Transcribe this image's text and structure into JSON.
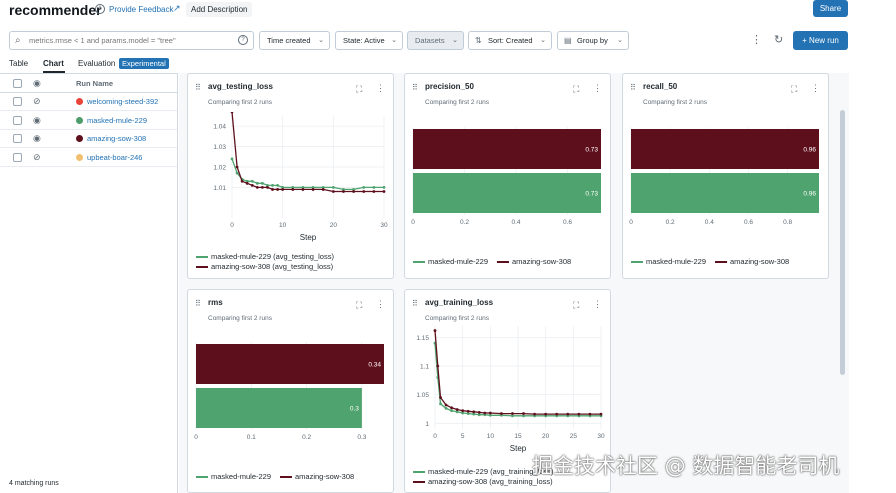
{
  "header": {
    "title": "recommender",
    "feedback": "Provide Feedback",
    "add_description": "Add Description",
    "share": "Share"
  },
  "toolbar": {
    "search_placeholder": "metrics.rmse < 1 and params.model = \"tree\"",
    "time_created": "Time created",
    "state": "State: Active",
    "datasets": "Datasets",
    "sort": "Sort: Created",
    "group_by": "Group by",
    "new_run": "New run"
  },
  "tabs": {
    "table": "Table",
    "chart": "Chart",
    "evaluation": "Evaluation",
    "experimental": "Experimental"
  },
  "runs": {
    "column_header": "Run Name",
    "items": [
      {
        "name": "welcoming-steed-392",
        "color": "#e8443a",
        "visible": false
      },
      {
        "name": "masked-mule-229",
        "color": "#4c9e6a",
        "visible": true
      },
      {
        "name": "amazing-sow-308",
        "color": "#5e0f1c",
        "visible": true
      },
      {
        "name": "upbeat-boar-246",
        "color": "#f0c070",
        "visible": false
      }
    ],
    "matching": "4 matching runs"
  },
  "colors": {
    "masked": "#4fa36e",
    "amazing": "#5e0f1c",
    "accent": "#2272b4"
  },
  "charts": {
    "subtitle": "Comparing first 2 runs",
    "avg_testing_loss": {
      "title": "avg_testing_loss",
      "xlabel": "Step",
      "legend": [
        "masked-mule-229 (avg_testing_loss)",
        "amazing-sow-308 (avg_testing_loss)"
      ]
    },
    "precision_50": {
      "title": "precision_50",
      "legend": [
        "masked-mule-229",
        "amazing-sow-308"
      ]
    },
    "recall_50": {
      "title": "recall_50",
      "legend": [
        "masked-mule-229",
        "amazing-sow-308"
      ]
    },
    "rms": {
      "title": "rms",
      "legend": [
        "masked-mule-229",
        "amazing-sow-308"
      ]
    },
    "avg_training_loss": {
      "title": "avg_training_loss",
      "xlabel": "Step",
      "legend": [
        "masked-mule-229 (avg_training_loss)",
        "amazing-sow-308 (avg_training_loss)"
      ]
    }
  },
  "chart_data": [
    {
      "type": "line",
      "title": "avg_testing_loss",
      "xlabel": "Step",
      "xlim": [
        0,
        30
      ],
      "ylim": [
        0.995,
        1.045
      ],
      "yticks": [
        1.01,
        1.02,
        1.03,
        1.04
      ],
      "xticks": [
        0,
        10,
        20,
        30
      ],
      "series": [
        {
          "name": "masked-mule-229 (avg_testing_loss)",
          "x": [
            0,
            1,
            2,
            3,
            4,
            5,
            6,
            7,
            8,
            9,
            10,
            12,
            14,
            16,
            18,
            20,
            22,
            24,
            26,
            28,
            30
          ],
          "values": [
            1.024,
            1.017,
            1.014,
            1.013,
            1.013,
            1.012,
            1.012,
            1.011,
            1.011,
            1.011,
            1.01,
            1.01,
            1.01,
            1.01,
            1.01,
            1.01,
            1.009,
            1.009,
            1.01,
            1.01,
            1.01
          ]
        },
        {
          "name": "amazing-sow-308 (avg_testing_loss)",
          "x": [
            0,
            1,
            2,
            3,
            4,
            5,
            6,
            7,
            8,
            9,
            10,
            12,
            14,
            16,
            18,
            20,
            22,
            24,
            26,
            28,
            30
          ],
          "values": [
            1.047,
            1.02,
            1.013,
            1.012,
            1.011,
            1.01,
            1.01,
            1.01,
            1.009,
            1.009,
            1.009,
            1.009,
            1.009,
            1.009,
            1.009,
            1.008,
            1.008,
            1.008,
            1.008,
            1.008,
            1.008
          ]
        }
      ]
    },
    {
      "type": "bar",
      "title": "precision_50",
      "orientation": "horizontal",
      "xlim": [
        0,
        0.73
      ],
      "xticks": [
        0,
        0.2,
        0.4,
        0.6
      ],
      "series": [
        {
          "name": "amazing-sow-308",
          "values": [
            0.73
          ]
        },
        {
          "name": "masked-mule-229",
          "values": [
            0.73
          ]
        }
      ]
    },
    {
      "type": "bar",
      "title": "recall_50",
      "orientation": "horizontal",
      "xlim": [
        0,
        0.96
      ],
      "xticks": [
        0,
        0.2,
        0.4,
        0.6,
        0.8
      ],
      "series": [
        {
          "name": "amazing-sow-308",
          "values": [
            0.96
          ]
        },
        {
          "name": "masked-mule-229",
          "values": [
            0.96
          ]
        }
      ]
    },
    {
      "type": "bar",
      "title": "rms",
      "orientation": "horizontal",
      "xlim": [
        0,
        0.34
      ],
      "xticks": [
        0,
        0.1,
        0.2,
        0.3
      ],
      "series": [
        {
          "name": "amazing-sow-308",
          "values": [
            0.34
          ]
        },
        {
          "name": "masked-mule-229",
          "values": [
            0.3
          ]
        }
      ]
    },
    {
      "type": "line",
      "title": "avg_training_loss",
      "xlabel": "Step",
      "xlim": [
        0,
        30
      ],
      "ylim": [
        0.99,
        1.17
      ],
      "yticks": [
        1,
        1.05,
        1.1,
        1.15
      ],
      "xticks": [
        0,
        5,
        10,
        15,
        20,
        25,
        30
      ],
      "series": [
        {
          "name": "masked-mule-229 (avg_training_loss)",
          "x": [
            0,
            0.5,
            1,
            2,
            3,
            4,
            5,
            6,
            7,
            8,
            9,
            10,
            12,
            14,
            16,
            18,
            20,
            22,
            24,
            26,
            28,
            30
          ],
          "values": [
            1.14,
            1.08,
            1.034,
            1.026,
            1.022,
            1.02,
            1.018,
            1.017,
            1.016,
            1.015,
            1.015,
            1.014,
            1.014,
            1.013,
            1.013,
            1.013,
            1.013,
            1.013,
            1.013,
            1.013,
            1.013,
            1.013
          ]
        },
        {
          "name": "amazing-sow-308 (avg_training_loss)",
          "x": [
            0,
            0.5,
            1,
            2,
            3,
            4,
            5,
            6,
            7,
            8,
            9,
            10,
            12,
            14,
            16,
            18,
            20,
            22,
            24,
            26,
            28,
            30
          ],
          "values": [
            1.162,
            1.1,
            1.045,
            1.032,
            1.027,
            1.024,
            1.022,
            1.021,
            1.02,
            1.019,
            1.018,
            1.018,
            1.017,
            1.017,
            1.017,
            1.016,
            1.016,
            1.016,
            1.016,
            1.016,
            1.016,
            1.016
          ]
        }
      ]
    }
  ],
  "watermark": "掘金技术社区 @ 数据智能老司机"
}
